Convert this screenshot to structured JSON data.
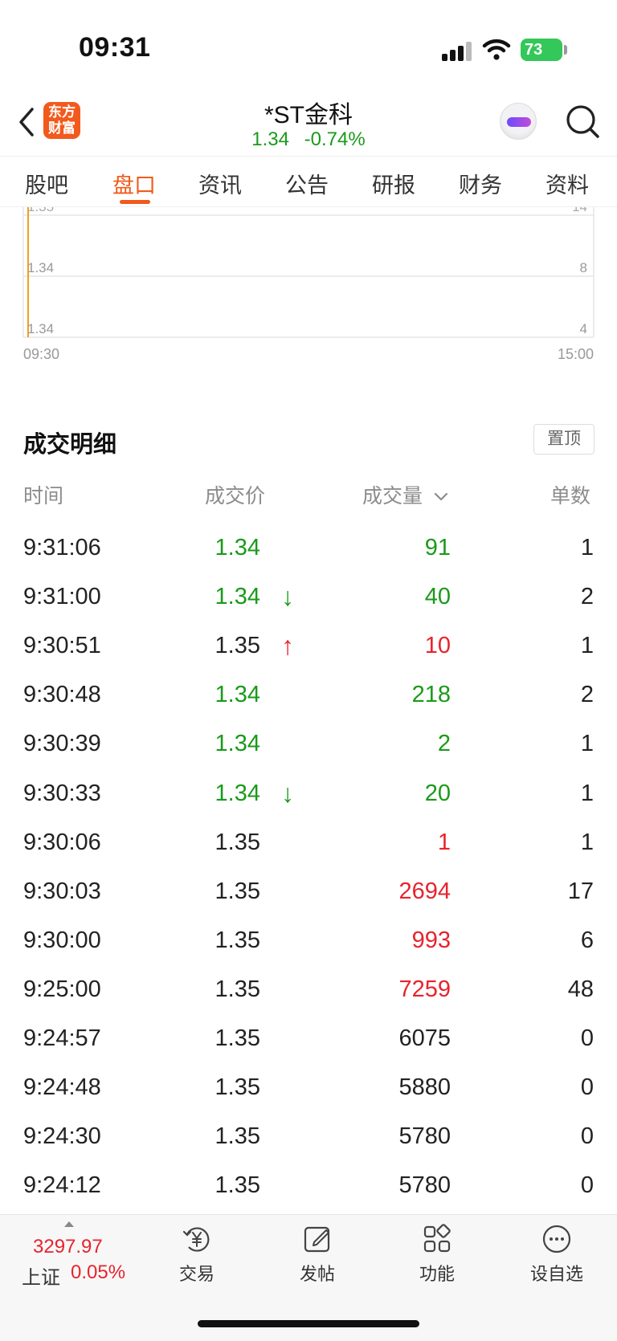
{
  "status": {
    "time": "09:31",
    "battery": "73"
  },
  "header": {
    "logo_line1": "东方",
    "logo_line2": "财富",
    "stock_name": "*ST金科",
    "price": "1.34",
    "change_pct": "-0.74%"
  },
  "tabs": [
    "股吧",
    "盘口",
    "资讯",
    "公告",
    "研报",
    "财务",
    "资料"
  ],
  "active_tab": "盘口",
  "chart": {
    "price_labels": [
      "1.35",
      "1.34",
      "1.34"
    ],
    "volume_labels": [
      "14",
      "8",
      "4"
    ],
    "start_time": "09:30",
    "end_time": "15:00",
    "line_color": "#f0a020"
  },
  "trades_section": {
    "title": "成交明细",
    "pin_label": "置顶",
    "col_time": "时间",
    "col_price": "成交价",
    "col_volume": "成交量",
    "col_count": "单数"
  },
  "trades": [
    {
      "time": "9:31:06",
      "price": "1.34",
      "dir": "",
      "volume": "91",
      "count": "1",
      "price_color": "green",
      "volume_color": "green"
    },
    {
      "time": "9:31:00",
      "price": "1.34",
      "dir": "↓",
      "volume": "40",
      "count": "2",
      "price_color": "green",
      "volume_color": "green"
    },
    {
      "time": "9:30:51",
      "price": "1.35",
      "dir": "↑",
      "volume": "10",
      "count": "1",
      "price_color": "dark",
      "volume_color": "red"
    },
    {
      "time": "9:30:48",
      "price": "1.34",
      "dir": "",
      "volume": "218",
      "count": "2",
      "price_color": "green",
      "volume_color": "green"
    },
    {
      "time": "9:30:39",
      "price": "1.34",
      "dir": "",
      "volume": "2",
      "count": "1",
      "price_color": "green",
      "volume_color": "green"
    },
    {
      "time": "9:30:33",
      "price": "1.34",
      "dir": "↓",
      "volume": "20",
      "count": "1",
      "price_color": "green",
      "volume_color": "green"
    },
    {
      "time": "9:30:06",
      "price": "1.35",
      "dir": "",
      "volume": "1",
      "count": "1",
      "price_color": "dark",
      "volume_color": "red"
    },
    {
      "time": "9:30:03",
      "price": "1.35",
      "dir": "",
      "volume": "2694",
      "count": "17",
      "price_color": "dark",
      "volume_color": "red"
    },
    {
      "time": "9:30:00",
      "price": "1.35",
      "dir": "",
      "volume": "993",
      "count": "6",
      "price_color": "dark",
      "volume_color": "red"
    },
    {
      "time": "9:25:00",
      "price": "1.35",
      "dir": "",
      "volume": "7259",
      "count": "48",
      "price_color": "dark",
      "volume_color": "red"
    },
    {
      "time": "9:24:57",
      "price": "1.35",
      "dir": "",
      "volume": "6075",
      "count": "0",
      "price_color": "dark",
      "volume_color": "dark"
    },
    {
      "time": "9:24:48",
      "price": "1.35",
      "dir": "",
      "volume": "5880",
      "count": "0",
      "price_color": "dark",
      "volume_color": "dark"
    },
    {
      "time": "9:24:30",
      "price": "1.35",
      "dir": "",
      "volume": "5780",
      "count": "0",
      "price_color": "dark",
      "volume_color": "dark"
    },
    {
      "time": "9:24:12",
      "price": "1.35",
      "dir": "",
      "volume": "5780",
      "count": "0",
      "price_color": "dark",
      "volume_color": "dark"
    }
  ],
  "bottom_bar": {
    "index_value": "3297.97",
    "index_name": "上证",
    "index_change": "0.05%",
    "items": [
      {
        "label": "交易",
        "icon": "trade-yen-icon"
      },
      {
        "label": "发帖",
        "icon": "compose-icon"
      },
      {
        "label": "功能",
        "icon": "apps-grid-icon"
      },
      {
        "label": "设自选",
        "icon": "more-icon"
      }
    ]
  },
  "colors": {
    "accent": "#ef5b1b",
    "up": "#e8232d",
    "down": "#1a9a1a"
  }
}
